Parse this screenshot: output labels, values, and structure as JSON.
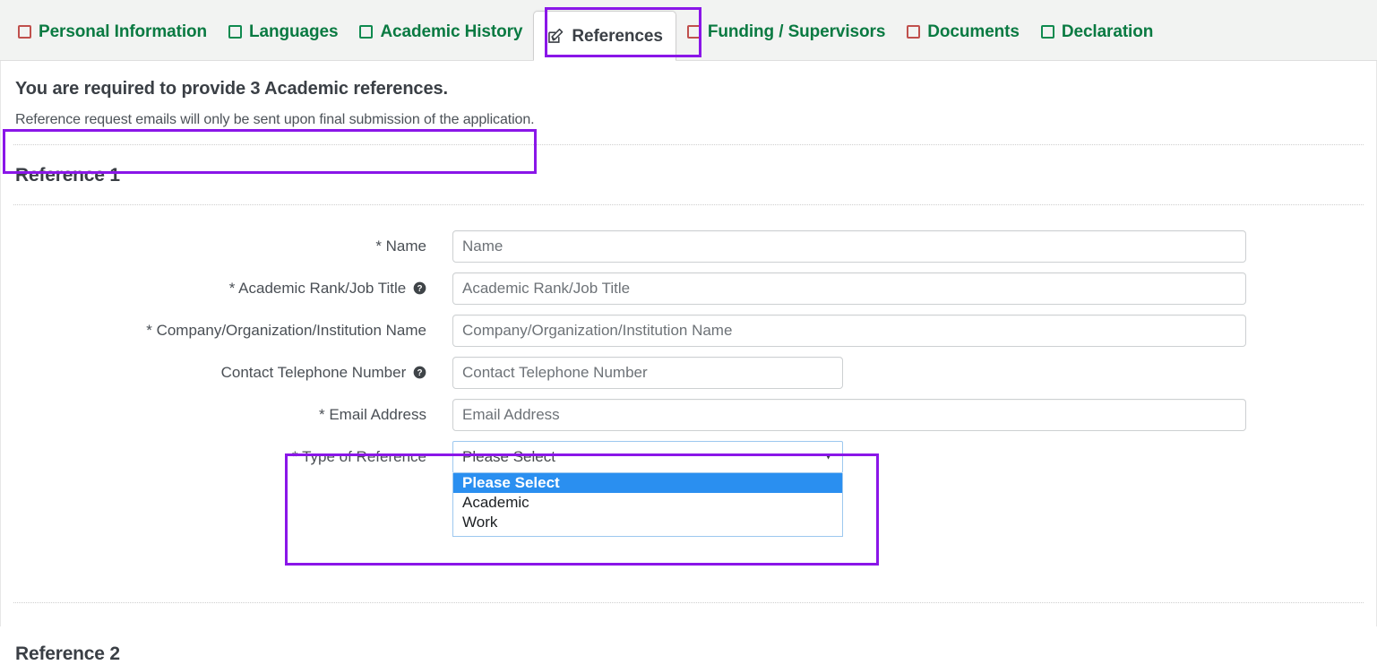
{
  "tabs": [
    {
      "label": "Personal Information",
      "state": "incomplete",
      "icon": "unchecked-checkbox-icon",
      "active": false
    },
    {
      "label": "Languages",
      "state": "complete",
      "icon": "unchecked-checkbox-icon",
      "active": false
    },
    {
      "label": "Academic History",
      "state": "complete",
      "icon": "unchecked-checkbox-icon",
      "active": false
    },
    {
      "label": "References",
      "state": "active",
      "icon": "edit-pencil-icon",
      "active": true
    },
    {
      "label": "Funding / Supervisors",
      "state": "incomplete",
      "icon": "unchecked-checkbox-icon",
      "active": false
    },
    {
      "label": "Documents",
      "state": "incomplete",
      "icon": "unchecked-checkbox-icon",
      "active": false
    },
    {
      "label": "Declaration",
      "state": "complete",
      "icon": "unchecked-checkbox-icon",
      "active": false
    }
  ],
  "notice": {
    "heading": "You are required to provide 3 Academic references.",
    "subtext": "Reference request emails will only be sent upon final submission of the application."
  },
  "sections": {
    "reference_1_title": "Reference 1",
    "reference_2_title": "Reference 2"
  },
  "form": {
    "name": {
      "label": "* Name",
      "placeholder": "Name",
      "value": ""
    },
    "rank": {
      "label": "* Academic Rank/Job Title",
      "placeholder": "Academic Rank/Job Title",
      "value": "",
      "help": "help-icon"
    },
    "organization": {
      "label": "* Company/Organization/Institution Name",
      "placeholder": "Company/Organization/Institution Name",
      "value": ""
    },
    "telephone": {
      "label": "Contact Telephone Number",
      "placeholder": "Contact Telephone Number",
      "value": "",
      "help": "help-icon"
    },
    "email": {
      "label": "* Email Address",
      "placeholder": "Email Address",
      "value": ""
    },
    "type_of_reference": {
      "label": "* Type of Reference",
      "selected": "Please Select",
      "expanded": true,
      "options": [
        "Please Select",
        "Academic",
        "Work"
      ]
    }
  },
  "colors": {
    "tab_text_green": "#0a7a42",
    "tab_box_incomplete": "#c0504d",
    "tab_box_complete": "#0f8a4f",
    "highlight_purple": "#8a16e8",
    "option_selected_blue": "#2a8ff0",
    "heading_text": "#3a3f45"
  }
}
